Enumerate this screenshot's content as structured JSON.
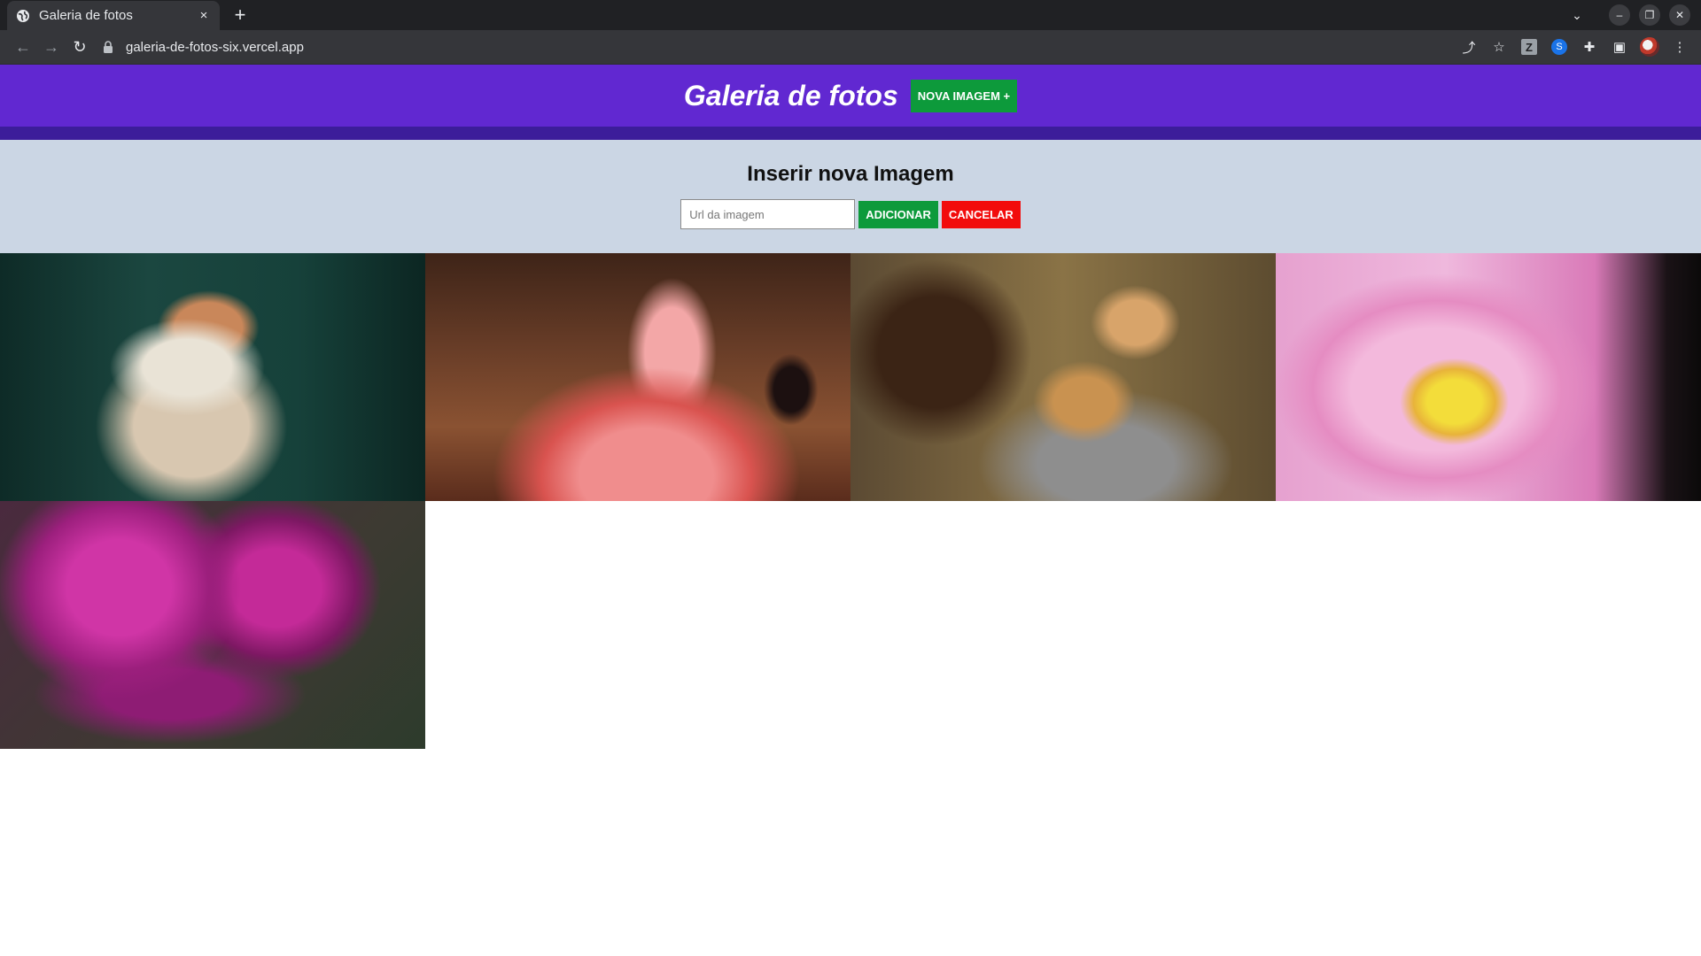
{
  "browser": {
    "tab_title": "Galeria de fotos",
    "tab_close": "×",
    "new_tab": "+",
    "url": "galeria-de-fotos-six.vercel.app",
    "icons": [
      "back-icon",
      "forward-icon",
      "reload-icon",
      "lock-icon",
      "share-icon",
      "star-icon",
      "extension-z-icon",
      "extension-shazam-icon",
      "puzzle-icon",
      "side-panel-icon",
      "profile-avatar",
      "menu-icon"
    ]
  },
  "header": {
    "title": "Galeria de fotos",
    "nova_button": "NOVA IMAGEM +",
    "color": "#6128d1"
  },
  "insert": {
    "title": "Inserir nova Imagem",
    "placeholder": "Url da imagem",
    "add_label": "ADICIONAR",
    "cancel_label": "CANCELAR",
    "add_color": "#0d9a3b",
    "cancel_color": "#f20c0c"
  },
  "gallery": {
    "photos": [
      {
        "subject": "cat"
      },
      {
        "subject": "flamingo"
      },
      {
        "subject": "puppies"
      },
      {
        "subject": "lotus flower with bee"
      },
      {
        "subject": "purple flower with raindrops"
      }
    ]
  }
}
